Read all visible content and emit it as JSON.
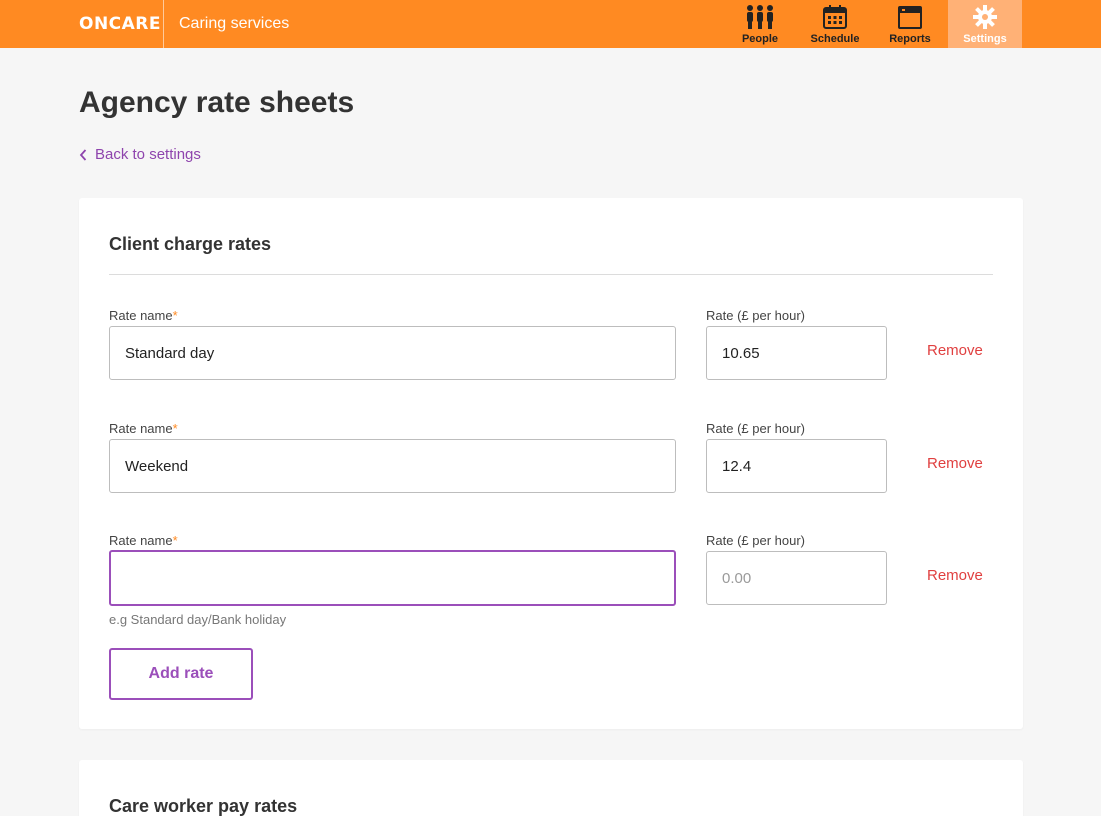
{
  "header": {
    "logo_text": "ONCARE",
    "company_name": "Caring services",
    "accent_color": "#ff8a22",
    "nav": [
      {
        "label": "People",
        "icon": "people-icon"
      },
      {
        "label": "Schedule",
        "icon": "calendar-icon"
      },
      {
        "label": "Reports",
        "icon": "reports-icon"
      },
      {
        "label": "Settings",
        "icon": "gear-icon",
        "active": true
      }
    ]
  },
  "page": {
    "title": "Agency rate sheets",
    "back_link": "Back to settings"
  },
  "client_rates": {
    "title": "Client charge rates",
    "rows": [
      {
        "name_label": "Rate name",
        "rate_label": "Rate (£ per hour)",
        "name_value": "Standard day",
        "rate_value": "10.65",
        "remove_label": "Remove"
      },
      {
        "name_label": "Rate name",
        "rate_label": "Rate (£ per hour)",
        "name_value": "Weekend",
        "rate_value": "12.4",
        "remove_label": "Remove"
      },
      {
        "name_label": "Rate name",
        "rate_label": "Rate (£ per hour)",
        "name_value": "",
        "rate_value": "",
        "rate_placeholder": "0.00",
        "remove_label": "Remove",
        "hint": "e.g Standard day/Bank holiday"
      }
    ],
    "add_button": "Add rate",
    "required_mark": "*"
  },
  "worker_rates": {
    "title": "Care worker pay rates"
  },
  "colors": {
    "link_purple": "#8e44ad",
    "focus_purple": "#9b4fba",
    "remove_red": "#e04040"
  }
}
